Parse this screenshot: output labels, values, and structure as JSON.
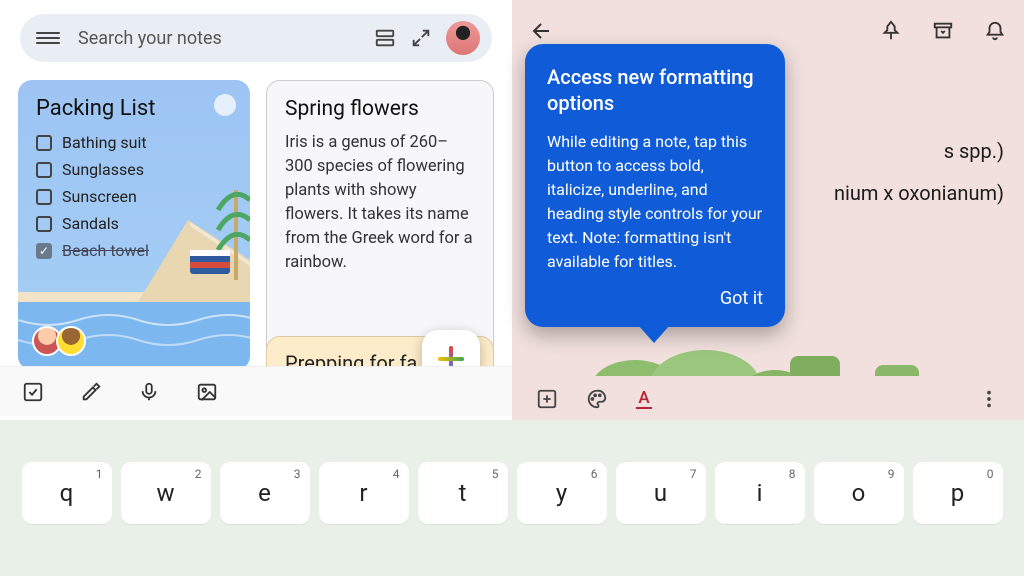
{
  "search": {
    "placeholder": "Search your notes"
  },
  "notes": {
    "packing": {
      "title": "Packing List",
      "items": [
        {
          "label": "Bathing suit",
          "checked": false
        },
        {
          "label": "Sunglasses",
          "checked": false
        },
        {
          "label": "Sunscreen",
          "checked": false
        },
        {
          "label": "Sandals",
          "checked": false
        },
        {
          "label": "Beach towel",
          "checked": true
        }
      ]
    },
    "spring": {
      "title": "Spring flowers",
      "body": "Iris is a genus of 260–300 species of flowering plants with showy flowers. It takes its name from the Greek word for a rainbow."
    },
    "prepping": {
      "title": "Prepping for fa"
    }
  },
  "right": {
    "line1_tail": "s spp.)",
    "line2_tail": "nium x oxonianum)"
  },
  "tooltip": {
    "title": "Access new formatting options",
    "body": "While editing a note, tap this button to access bold, italicize, underline, and heading style controls for your text. Note: formatting isn't available for titles.",
    "action": "Got it"
  },
  "keyboard": {
    "row1": [
      {
        "k": "q",
        "n": "1"
      },
      {
        "k": "w",
        "n": "2"
      },
      {
        "k": "e",
        "n": "3"
      },
      {
        "k": "r",
        "n": "4"
      },
      {
        "k": "t",
        "n": "5"
      },
      {
        "k": "y",
        "n": "6"
      },
      {
        "k": "u",
        "n": "7"
      },
      {
        "k": "i",
        "n": "8"
      },
      {
        "k": "o",
        "n": "9"
      },
      {
        "k": "p",
        "n": "0"
      }
    ]
  }
}
